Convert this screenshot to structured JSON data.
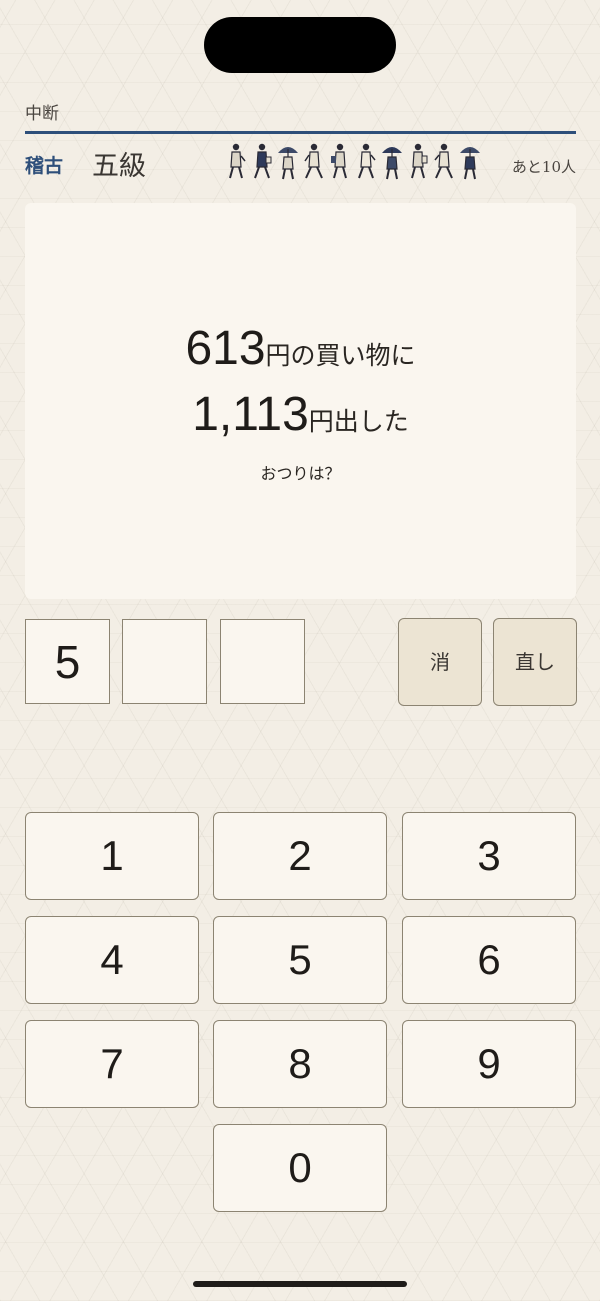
{
  "header": {
    "quit_label": "中断",
    "mode_label": "稽古",
    "grade_label": "五級",
    "remaining_label": "あと10人",
    "walker_icon": "walking-traveler-icon",
    "accent_color": "#2e4f7a"
  },
  "question": {
    "price": "613",
    "price_suffix": "円の買い物に",
    "paid": "1,113",
    "paid_suffix": "円出した",
    "ask": "おつりは？"
  },
  "answer": {
    "digits": [
      "5",
      "",
      ""
    ]
  },
  "controls": {
    "erase_label": "消",
    "reset_label": "直し"
  },
  "keypad": {
    "keys": [
      "1",
      "2",
      "3",
      "4",
      "5",
      "6",
      "7",
      "8",
      "9",
      "0"
    ]
  }
}
